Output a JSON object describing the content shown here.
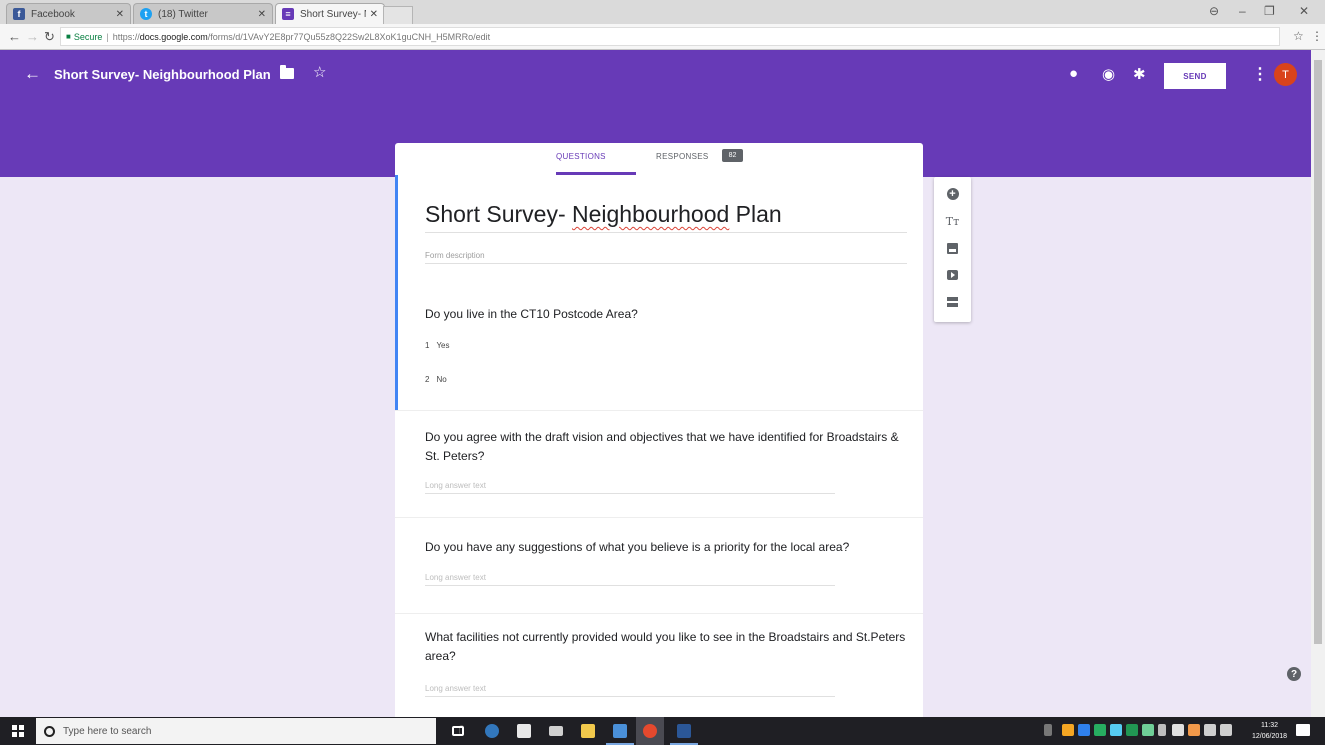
{
  "browser": {
    "tabs": [
      {
        "title": "Facebook",
        "favicon_color": "#3b5998",
        "favicon_glyph": "f"
      },
      {
        "title": "(18) Twitter",
        "favicon_color": "#1da1f2",
        "favicon_glyph": "t"
      },
      {
        "title": "Short Survey- Neighbour",
        "favicon_color": "#673ab7",
        "favicon_glyph": "≡"
      }
    ],
    "secure_label": "Secure",
    "url_scheme": "https://",
    "url_host": "docs.google.com",
    "url_path": "/forms/d/1VAvY2E8pr77Qu55z8Q22Sw2L8XoK1guCNH_H5MRRo/edit"
  },
  "header": {
    "title": "Short Survey- Neighbourhood Plan",
    "send_label": "SEND",
    "avatar_letter": "T",
    "theme_color": "#673ab7"
  },
  "tabs": {
    "questions": "QUESTIONS",
    "responses": "RESPONSES",
    "responses_count": "82"
  },
  "form": {
    "title_prefix": "Short Survey- ",
    "title_misspelled": "Neighbourhood",
    "title_suffix": " Plan",
    "description_placeholder": "Form description",
    "questions": [
      {
        "text": "Do you live in the CT10 Postcode Area?",
        "options": [
          {
            "num": "1",
            "label": "Yes"
          },
          {
            "num": "2",
            "label": "No"
          }
        ]
      },
      {
        "text": "Do you agree with the draft vision and objectives that we have identified for Broadstairs & St. Peters?",
        "placeholder": "Long answer text"
      },
      {
        "text": "Do you have any suggestions of what you believe is a priority for the local area?",
        "placeholder": "Long answer text"
      },
      {
        "text": "What facilities not currently provided would you like to see in the Broadstairs and St.Peters area?",
        "placeholder": "Long answer text"
      }
    ]
  },
  "toolbar": {
    "title_text_glyph": "Tт"
  },
  "taskbar": {
    "search_placeholder": "Type here to search",
    "time": "11:32",
    "date": "12/06/2018"
  }
}
